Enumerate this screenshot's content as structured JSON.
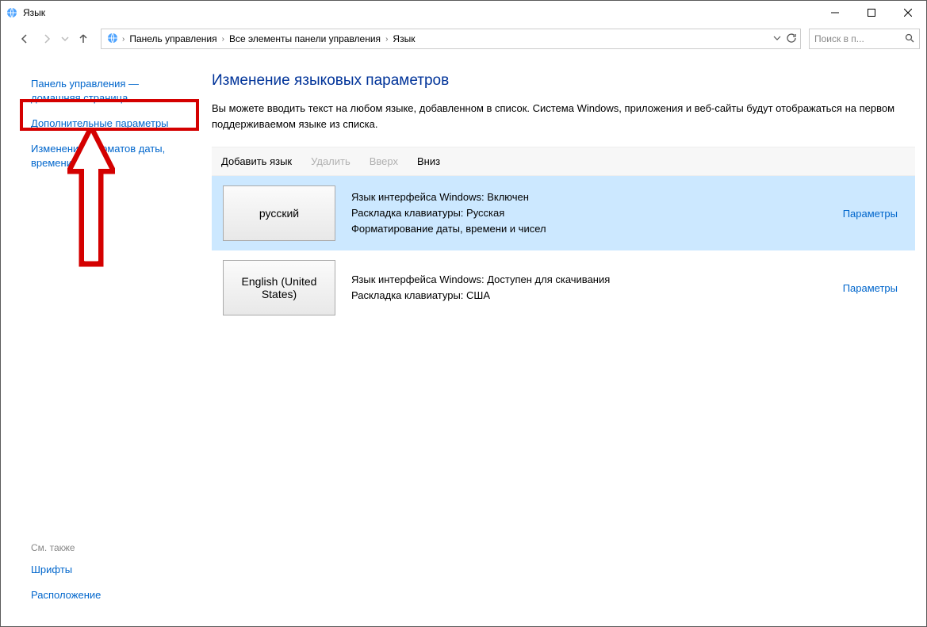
{
  "window": {
    "title": "Язык"
  },
  "breadcrumb": {
    "items": [
      "Панель управления",
      "Все элементы панели управления",
      "Язык"
    ]
  },
  "search": {
    "placeholder": "Поиск в п..."
  },
  "sidebar": {
    "links": {
      "home": "Панель управления — домашняя страница",
      "advanced": "Дополнительные параметры",
      "datetime": "Изменение форматов даты, времени и чисел"
    },
    "see_also_label": "См. также",
    "see_also": {
      "fonts": "Шрифты",
      "location": "Расположение"
    }
  },
  "main": {
    "heading": "Изменение языковых параметров",
    "description": "Вы можете вводить текст на любом языке, добавленном в список. Система Windows, приложения и веб-сайты будут отображаться на первом поддерживаемом языке из списка."
  },
  "toolbar": {
    "add": "Добавить язык",
    "remove": "Удалить",
    "up": "Вверх",
    "down": "Вниз"
  },
  "languages": [
    {
      "name": "русский",
      "lines": {
        "l1": "Язык интерфейса Windows: Включен",
        "l2": "Раскладка клавиатуры: Русская",
        "l3": "Форматирование даты, времени и чисел"
      },
      "options": "Параметры",
      "selected": true
    },
    {
      "name": "English (United States)",
      "lines": {
        "l1": "Язык интерфейса Windows: Доступен для скачивания",
        "l2": "Раскладка клавиатуры: США",
        "l3": ""
      },
      "options": "Параметры",
      "selected": false
    }
  ]
}
